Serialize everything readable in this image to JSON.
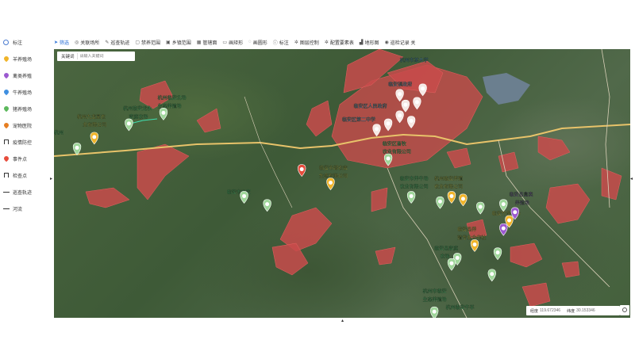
{
  "legend": {
    "items": [
      {
        "label": "标注",
        "icon": "info-icon",
        "color": "#4a7bd0",
        "kind": "info"
      },
      {
        "label": "羊养殖场",
        "icon": "pin-icon",
        "color": "#f0b429",
        "kind": "pin"
      },
      {
        "label": "禽类养殖",
        "icon": "pin-icon",
        "color": "#9b59d0",
        "kind": "pin"
      },
      {
        "label": "牛养殖场",
        "icon": "pin-icon",
        "color": "#3f8fe0",
        "kind": "pin"
      },
      {
        "label": "猪养殖场",
        "icon": "pin-icon",
        "color": "#5cb85c",
        "kind": "pin"
      },
      {
        "label": "宠物医院",
        "icon": "pin-icon",
        "color": "#e67e22",
        "kind": "pin"
      },
      {
        "label": "疫情防控",
        "icon": "gate-icon",
        "color": "#333333",
        "kind": "gate"
      },
      {
        "label": "事件点",
        "icon": "pin-icon",
        "color": "#e74c3c",
        "kind": "pin"
      },
      {
        "label": "检查点",
        "icon": "gate-icon",
        "color": "#333333",
        "kind": "gate"
      },
      {
        "label": "巡查轨迹",
        "icon": "line-icon",
        "color": "#333333",
        "kind": "line"
      },
      {
        "label": "河流",
        "icon": "line-icon",
        "color": "#333333",
        "kind": "line"
      }
    ]
  },
  "toolbar": {
    "items": [
      {
        "label": "筛选",
        "icon": "cursor-icon",
        "active": true
      },
      {
        "label": "关联场所",
        "icon": "pin-outline-icon",
        "active": false
      },
      {
        "label": "巡查轨迹",
        "icon": "pencil-icon",
        "active": false
      },
      {
        "label": "禁养范围",
        "icon": "square-icon",
        "active": false
      },
      {
        "label": "乡镇范围",
        "icon": "box-icon",
        "active": false
      },
      {
        "label": "管辖面",
        "icon": "grid-icon",
        "active": false
      },
      {
        "label": "画矩形",
        "icon": "rect-icon",
        "active": false
      },
      {
        "label": "画圆形",
        "icon": "circle-icon",
        "active": false
      },
      {
        "label": "标注",
        "icon": "info-icon",
        "active": false
      },
      {
        "label": "图层控制",
        "icon": "gear-icon",
        "active": false
      },
      {
        "label": "配置要素表",
        "icon": "gear-icon",
        "active": false
      },
      {
        "label": "地形图",
        "icon": "chart-icon",
        "active": false
      },
      {
        "label": "巡检记录 关",
        "icon": "eye-icon",
        "active": false
      }
    ]
  },
  "search": {
    "keyword_label": "关键词",
    "placeholder": "请输入关键词"
  },
  "coordinates": {
    "lon_label": "经度",
    "lon_value": "119.672346",
    "lat_label": "纬度",
    "lat_value": "30.153346"
  },
  "map": {
    "labels": [
      {
        "text": "杭州九龙星农",
        "fx": 0.04,
        "fy": 0.24,
        "color": "#f7e15a"
      },
      {
        "text": "业有限公司",
        "fx": 0.05,
        "fy": 0.27,
        "color": "#f7e15a"
      },
      {
        "text": "杭州临安龙永",
        "fx": 0.12,
        "fy": 0.21,
        "color": "#5ce08a"
      },
      {
        "text": "家庭农场",
        "fx": 0.13,
        "fy": 0.24,
        "color": "#5ce08a"
      },
      {
        "text": "杭州临安北场",
        "fx": 0.18,
        "fy": 0.17,
        "color": "#5ce08a"
      },
      {
        "text": "生态养殖场",
        "fx": 0.18,
        "fy": 0.2,
        "color": "#5ce08a"
      },
      {
        "text": "杭州",
        "fx": 0.0,
        "fy": 0.3,
        "color": "#5ce08a"
      },
      {
        "text": "临安市农家",
        "fx": 0.3,
        "fy": 0.52,
        "color": "#5ce08a"
      },
      {
        "text": "临安市绿农家",
        "fx": 0.46,
        "fy": 0.43,
        "color": "#f7e15a"
      },
      {
        "text": "生态有限公司",
        "fx": 0.46,
        "fy": 0.46,
        "color": "#f7e15a"
      },
      {
        "text": "杭州市某大学",
        "fx": 0.6,
        "fy": 0.03,
        "color": "#5ea8ff"
      },
      {
        "text": "临安镇政府",
        "fx": 0.58,
        "fy": 0.12,
        "color": "#5ea8ff"
      },
      {
        "text": "临安区人民政府",
        "fx": 0.52,
        "fy": 0.2,
        "color": "#5ea8ff"
      },
      {
        "text": "临安区第二中学",
        "fx": 0.5,
        "fy": 0.25,
        "color": "#5ea8ff"
      },
      {
        "text": "临安区畜牧",
        "fx": 0.57,
        "fy": 0.34,
        "color": "#5ce08a"
      },
      {
        "text": "农业有限公司",
        "fx": 0.57,
        "fy": 0.37,
        "color": "#5ce08a"
      },
      {
        "text": "临安市养牛场",
        "fx": 0.6,
        "fy": 0.47,
        "color": "#5ce08a"
      },
      {
        "text": "农业有限公司",
        "fx": 0.6,
        "fy": 0.5,
        "color": "#5ce08a"
      },
      {
        "text": "杭州临安养殖",
        "fx": 0.66,
        "fy": 0.47,
        "color": "#f7e15a"
      },
      {
        "text": "农业有限公司",
        "fx": 0.66,
        "fy": 0.5,
        "color": "#f7e15a"
      },
      {
        "text": "临安县禽类",
        "fx": 0.79,
        "fy": 0.53,
        "color": "#9b59d0"
      },
      {
        "text": "养殖场",
        "fx": 0.8,
        "fy": 0.56,
        "color": "#9b59d0"
      },
      {
        "text": "临安竹海农场",
        "fx": 0.76,
        "fy": 0.6,
        "color": "#f7e15a"
      },
      {
        "text": "临安县养",
        "fx": 0.7,
        "fy": 0.66,
        "color": "#f7e15a"
      },
      {
        "text": "殖专业合作社",
        "fx": 0.7,
        "fy": 0.69,
        "color": "#f7e15a"
      },
      {
        "text": "临安县家庭",
        "fx": 0.66,
        "fy": 0.73,
        "color": "#5ce08a"
      },
      {
        "text": "农场",
        "fx": 0.67,
        "fy": 0.76,
        "color": "#5ce08a"
      },
      {
        "text": "杭州市临安",
        "fx": 0.64,
        "fy": 0.89,
        "color": "#5ce08a"
      },
      {
        "text": "生态养殖场",
        "fx": 0.64,
        "fy": 0.92,
        "color": "#5ce08a"
      },
      {
        "text": "杭州临安牛羊",
        "fx": 0.68,
        "fy": 0.95,
        "color": "#5ce08a"
      }
    ],
    "markers": [
      {
        "fx": 0.04,
        "fy": 0.37,
        "color": "#9fd69a",
        "kind": "pig"
      },
      {
        "fx": 0.13,
        "fy": 0.28,
        "color": "#9fd69a",
        "kind": "pig"
      },
      {
        "fx": 0.19,
        "fy": 0.24,
        "color": "#9fd69a",
        "kind": "pig"
      },
      {
        "fx": 0.07,
        "fy": 0.33,
        "color": "#f0b429",
        "kind": "sheep"
      },
      {
        "fx": 0.33,
        "fy": 0.55,
        "color": "#9fd69a",
        "kind": "pig"
      },
      {
        "fx": 0.37,
        "fy": 0.58,
        "color": "#9fd69a",
        "kind": "pig"
      },
      {
        "fx": 0.43,
        "fy": 0.45,
        "color": "#e74c3c",
        "kind": "event"
      },
      {
        "fx": 0.48,
        "fy": 0.5,
        "color": "#f0b429",
        "kind": "sheep"
      },
      {
        "fx": 0.58,
        "fy": 0.41,
        "color": "#9fd69a",
        "kind": "pig"
      },
      {
        "fx": 0.62,
        "fy": 0.55,
        "color": "#9fd69a",
        "kind": "pig"
      },
      {
        "fx": 0.67,
        "fy": 0.57,
        "color": "#9fd69a",
        "kind": "pig"
      },
      {
        "fx": 0.69,
        "fy": 0.55,
        "color": "#f0b429",
        "kind": "sheep"
      },
      {
        "fx": 0.71,
        "fy": 0.56,
        "color": "#f0b429",
        "kind": "sheep"
      },
      {
        "fx": 0.74,
        "fy": 0.59,
        "color": "#9fd69a",
        "kind": "pig"
      },
      {
        "fx": 0.78,
        "fy": 0.58,
        "color": "#9fd69a",
        "kind": "pig"
      },
      {
        "fx": 0.8,
        "fy": 0.61,
        "color": "#9b59d0",
        "kind": "poultry"
      },
      {
        "fx": 0.78,
        "fy": 0.67,
        "color": "#9b59d0",
        "kind": "poultry"
      },
      {
        "fx": 0.79,
        "fy": 0.64,
        "color": "#f0b429",
        "kind": "sheep"
      },
      {
        "fx": 0.73,
        "fy": 0.73,
        "color": "#f0b429",
        "kind": "sheep"
      },
      {
        "fx": 0.77,
        "fy": 0.76,
        "color": "#9fd69a",
        "kind": "pig"
      },
      {
        "fx": 0.7,
        "fy": 0.78,
        "color": "#9fd69a",
        "kind": "pig"
      },
      {
        "fx": 0.69,
        "fy": 0.8,
        "color": "#9fd69a",
        "kind": "pig"
      },
      {
        "fx": 0.76,
        "fy": 0.84,
        "color": "#9fd69a",
        "kind": "pig"
      },
      {
        "fx": 0.66,
        "fy": 0.98,
        "color": "#9fd69a",
        "kind": "pig"
      },
      {
        "fx": 0.6,
        "fy": 0.17,
        "color": "#f5e9e5",
        "kind": "urban"
      },
      {
        "fx": 0.61,
        "fy": 0.21,
        "color": "#f5e9e5",
        "kind": "urban"
      },
      {
        "fx": 0.6,
        "fy": 0.25,
        "color": "#f5e9e5",
        "kind": "urban"
      },
      {
        "fx": 0.63,
        "fy": 0.2,
        "color": "#f5e9e5",
        "kind": "urban"
      },
      {
        "fx": 0.62,
        "fy": 0.27,
        "color": "#f5e9e5",
        "kind": "urban"
      },
      {
        "fx": 0.58,
        "fy": 0.28,
        "color": "#f5e9e5",
        "kind": "urban"
      },
      {
        "fx": 0.56,
        "fy": 0.3,
        "color": "#f5e9e5",
        "kind": "urban"
      },
      {
        "fx": 0.64,
        "fy": 0.15,
        "color": "#f5e9e5",
        "kind": "urban"
      }
    ]
  }
}
